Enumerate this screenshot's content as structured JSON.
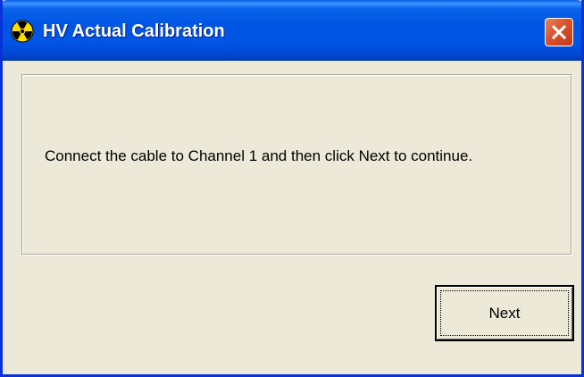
{
  "window": {
    "title": "HV Actual Calibration",
    "title_icon": "radiation-icon",
    "close_icon": "close-icon"
  },
  "message": {
    "text": "Connect the cable to Channel 1 and then click Next to continue."
  },
  "buttons": {
    "next_label": "Next"
  },
  "colors": {
    "titlebar": "#0054e3",
    "window_frame": "#0831d9",
    "dialog_background": "#ece9d8",
    "close_button": "#d8522c"
  }
}
